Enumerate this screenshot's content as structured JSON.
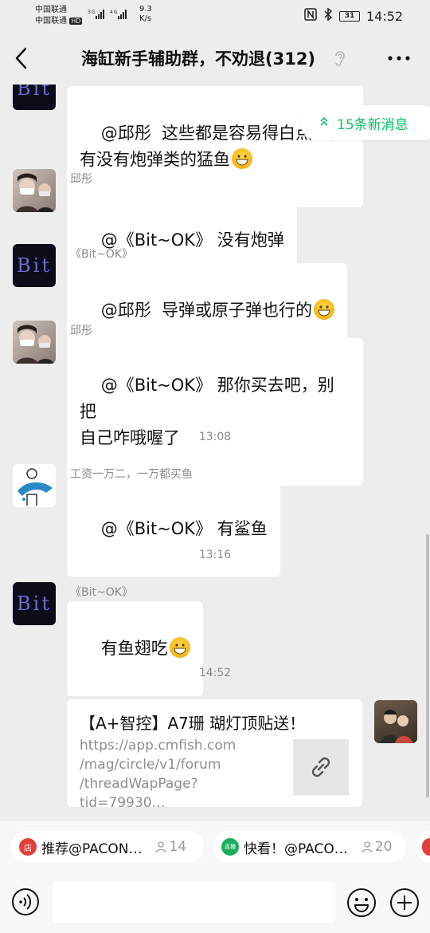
{
  "status": {
    "carrier1": "中国联通",
    "carrier2": "中国联通",
    "hd": "HD",
    "net": "3G 4G",
    "speed_value": "9.3",
    "speed_unit": "K/s",
    "battery": "31",
    "time": "14:52"
  },
  "header": {
    "title": "海缸新手辅助群，不劝退(312)"
  },
  "new_messages": "15条新消息",
  "messages": [
    {
      "sender": "",
      "text": "@邱彤  这些都是容易得白点的，有没有炮弹类的猛鱼"
    },
    {
      "sender": "邱彤",
      "text": "@《Bit~OK》 没有炮弹"
    },
    {
      "sender": "《Bit~OK》",
      "text": "@邱彤  导弹或原子弹也行的"
    },
    {
      "sender": "邱彤",
      "text": "@《Bit~OK》 那你买去吧，别把\n自己咋哦喔了"
    },
    {
      "sender": "工资一万二，一万都买鱼",
      "text": "@《Bit~OK》 有鲨鱼"
    },
    {
      "sender": "《Bit~OK》",
      "text": "有鱼翅吃"
    }
  ],
  "avatar_text": "Bit",
  "times": [
    "13:08",
    "13:16",
    "14:52"
  ],
  "link_card": {
    "title": "【A+智控】A7珊 瑚灯顶贴送！",
    "url": "https://app.cmfish.com\n/mag/circle/v1/forum\n/threadWapPage?tid=79930…"
  },
  "recommend": [
    {
      "icon": "店",
      "label": "推荐@PACON…",
      "count": "14",
      "color": "#e0403a"
    },
    {
      "icon": "直播",
      "label": "快看！@PACO…",
      "count": "20",
      "color": "#1aad5c"
    }
  ],
  "colors": {
    "accent": "#07c160",
    "background": "#ededed",
    "bubble": "#ffffff"
  }
}
